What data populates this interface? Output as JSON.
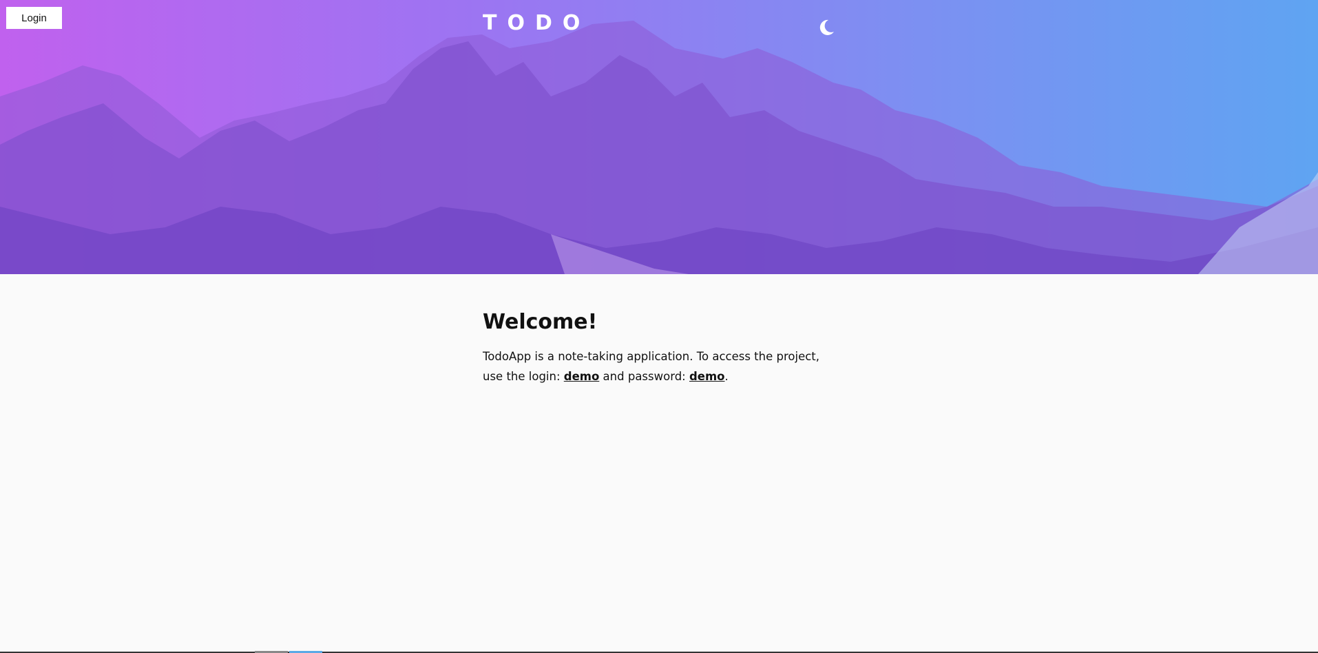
{
  "header": {
    "login_label": "Login",
    "app_title": "TODO",
    "theme_icon": "moon-icon",
    "gradient_colors": [
      "#c061ee",
      "#9d74f2",
      "#7c90f2",
      "#5fa4f2"
    ]
  },
  "main": {
    "heading": "Welcome!",
    "intro_part1": "TodoApp is a note-taking application. To access the project, use the login: ",
    "login_value": "demo",
    "intro_part2": " and password: ",
    "password_value": "demo",
    "intro_end": "."
  },
  "colors": {
    "background": "#fafafa",
    "text": "#111111"
  }
}
